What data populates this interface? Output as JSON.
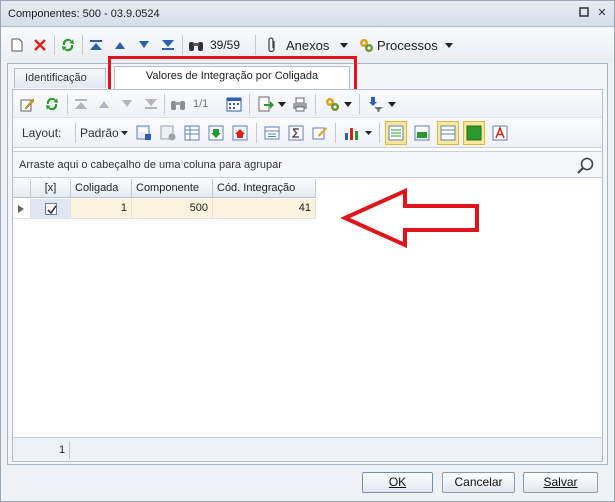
{
  "window": {
    "title": "Componentes: 500 - 03.9.0524"
  },
  "toolbar": {
    "record_position": "39/59",
    "attachments_label": "Anexos",
    "processes_label": "Processos"
  },
  "tabs": [
    {
      "label": "Identificação",
      "active": false
    },
    {
      "label": "Valores de Integração por Coligada",
      "active": true
    }
  ],
  "grid_toolbar": {
    "record_position": "1/1",
    "layout_label": "Layout:",
    "layout_value": "Padrão"
  },
  "grid": {
    "group_placeholder": "Arraste aqui o cabeçalho de uma coluna para agrupar",
    "columns": [
      "[x]",
      "Coligada",
      "Componente",
      "Cód. Integração"
    ],
    "rows": [
      {
        "checked": true,
        "coligada": "1",
        "componente": "500",
        "cod_integracao": "41"
      }
    ],
    "row_count": "1"
  },
  "buttons": {
    "ok": "OK",
    "cancel": "Cancelar",
    "save": "Salvar"
  },
  "colors": {
    "highlight": "#e0151b",
    "arrow": "#e0151b",
    "selected_cell": "#fbf3dd"
  }
}
